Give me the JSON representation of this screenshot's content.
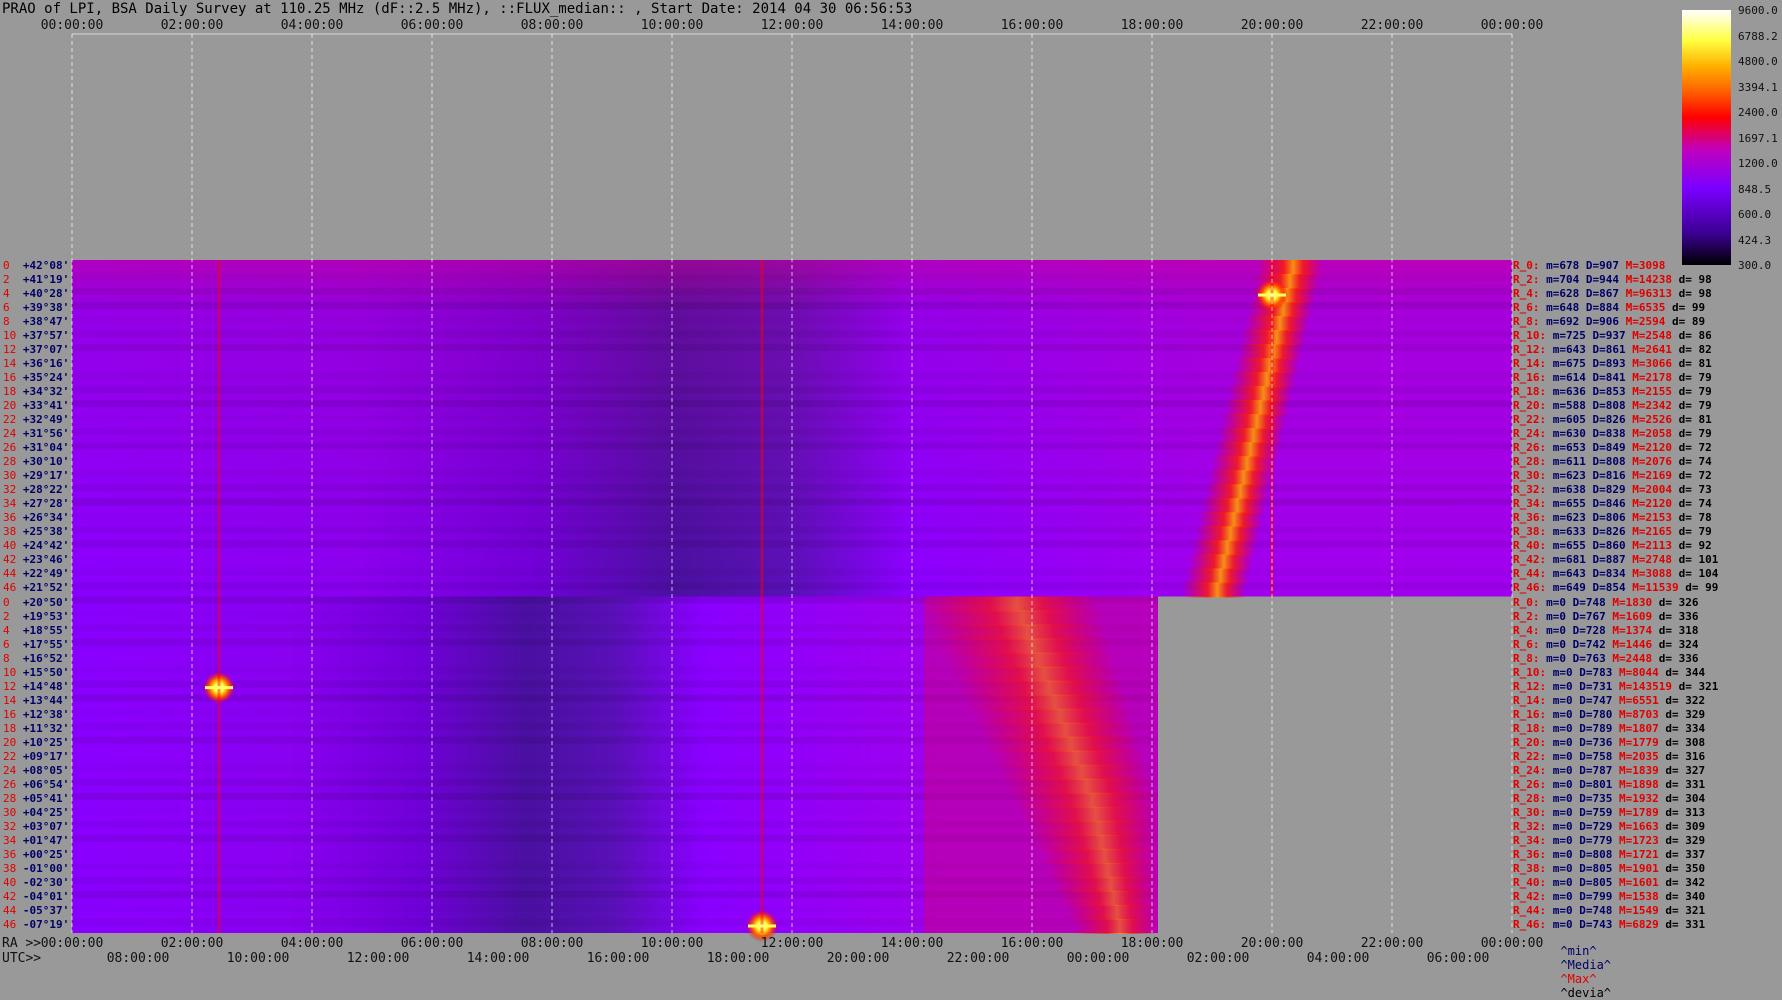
{
  "title": "PRAO of LPI, BSA Daily Survey at 110.25 MHz (dF::2.5 MHz), ::FLUX_median:: , Start Date: 2014 04 30 06:56:53",
  "top_axis_ticks": [
    "00:00:00",
    "02:00:00",
    "04:00:00",
    "06:00:00",
    "08:00:00",
    "10:00:00",
    "12:00:00",
    "14:00:00",
    "16:00:00",
    "18:00:00",
    "20:00:00",
    "22:00:00",
    "00:00:00"
  ],
  "ra_axis": {
    "label": "RA >>",
    "ticks": [
      "00:00:00",
      "02:00:00",
      "04:00:00",
      "06:00:00",
      "08:00:00",
      "10:00:00",
      "12:00:00",
      "14:00:00",
      "16:00:00",
      "18:00:00",
      "20:00:00",
      "22:00:00",
      "00:00:00"
    ]
  },
  "utc_axis": {
    "label": "UTC>>",
    "ticks": [
      "08:00:00",
      "10:00:00",
      "12:00:00",
      "14:00:00",
      "16:00:00",
      "18:00:00",
      "20:00:00",
      "22:00:00",
      "00:00:00",
      "02:00:00",
      "04:00:00",
      "06:00:00"
    ]
  },
  "colorbar": {
    "labels": [
      "9600.0",
      "6788.2",
      "4800.0",
      "3394.1",
      "2400.0",
      "1697.1",
      "1200.0",
      "848.5",
      "600.0",
      "424.3",
      "300.0"
    ]
  },
  "rows": [
    {
      "idx": "0",
      "dec": "+42°08'"
    },
    {
      "idx": "2",
      "dec": "+41°19'"
    },
    {
      "idx": "4",
      "dec": "+40°28'"
    },
    {
      "idx": "6",
      "dec": "+39°38'"
    },
    {
      "idx": "8",
      "dec": "+38°47'"
    },
    {
      "idx": "10",
      "dec": "+37°57'"
    },
    {
      "idx": "12",
      "dec": "+37°07'"
    },
    {
      "idx": "14",
      "dec": "+36°16'"
    },
    {
      "idx": "16",
      "dec": "+35°24'"
    },
    {
      "idx": "18",
      "dec": "+34°32'"
    },
    {
      "idx": "20",
      "dec": "+33°41'"
    },
    {
      "idx": "22",
      "dec": "+32°49'"
    },
    {
      "idx": "24",
      "dec": "+31°56'"
    },
    {
      "idx": "26",
      "dec": "+31°04'"
    },
    {
      "idx": "28",
      "dec": "+30°10'"
    },
    {
      "idx": "30",
      "dec": "+29°17'"
    },
    {
      "idx": "32",
      "dec": "+28°22'"
    },
    {
      "idx": "34",
      "dec": "+27°28'"
    },
    {
      "idx": "36",
      "dec": "+26°34'"
    },
    {
      "idx": "38",
      "dec": "+25°38'"
    },
    {
      "idx": "40",
      "dec": "+24°42'"
    },
    {
      "idx": "42",
      "dec": "+23°46'"
    },
    {
      "idx": "44",
      "dec": "+22°49'"
    },
    {
      "idx": "46",
      "dec": "+21°52'"
    },
    {
      "idx": "0",
      "dec": "+20°50'"
    },
    {
      "idx": "2",
      "dec": "+19°53'"
    },
    {
      "idx": "4",
      "dec": "+18°55'"
    },
    {
      "idx": "6",
      "dec": "+17°55'"
    },
    {
      "idx": "8",
      "dec": "+16°52'"
    },
    {
      "idx": "10",
      "dec": "+15°50'"
    },
    {
      "idx": "12",
      "dec": "+14°48'"
    },
    {
      "idx": "14",
      "dec": "+13°44'"
    },
    {
      "idx": "16",
      "dec": "+12°38'"
    },
    {
      "idx": "18",
      "dec": "+11°32'"
    },
    {
      "idx": "20",
      "dec": "+10°25'"
    },
    {
      "idx": "22",
      "dec": "+09°17'"
    },
    {
      "idx": "24",
      "dec": "+08°05'"
    },
    {
      "idx": "26",
      "dec": "+06°54'"
    },
    {
      "idx": "28",
      "dec": "+05°41'"
    },
    {
      "idx": "30",
      "dec": "+04°25'"
    },
    {
      "idx": "32",
      "dec": "+03°07'"
    },
    {
      "idx": "34",
      "dec": "+01°47'"
    },
    {
      "idx": "36",
      "dec": "+00°25'"
    },
    {
      "idx": "38",
      "dec": "-01°00'"
    },
    {
      "idx": "40",
      "dec": "-02°30'"
    },
    {
      "idx": "42",
      "dec": "-04°01'"
    },
    {
      "idx": "44",
      "dec": "-05°37'"
    },
    {
      "idx": "46",
      "dec": "-07°19'"
    }
  ],
  "stats": [
    {
      "r": "R_0:",
      "m": "m=678",
      "d": "D=907",
      "h": "M=3098",
      "dv": ""
    },
    {
      "r": "R_2:",
      "m": "m=704",
      "d": "D=944",
      "h": "M=14238",
      "dv": "d= 98"
    },
    {
      "r": "R_4:",
      "m": "m=628",
      "d": "D=867",
      "h": "M=96313",
      "dv": "d= 98"
    },
    {
      "r": "R_6:",
      "m": "m=648",
      "d": "D=884",
      "h": "M=6535",
      "dv": "d= 99"
    },
    {
      "r": "R_8:",
      "m": "m=692",
      "d": "D=906",
      "h": "M=2594",
      "dv": "d= 89"
    },
    {
      "r": "R_10:",
      "m": "m=725",
      "d": "D=937",
      "h": "M=2548",
      "dv": "d= 86"
    },
    {
      "r": "R_12:",
      "m": "m=643",
      "d": "D=861",
      "h": "M=2641",
      "dv": "d= 82"
    },
    {
      "r": "R_14:",
      "m": "m=675",
      "d": "D=893",
      "h": "M=3066",
      "dv": "d= 81"
    },
    {
      "r": "R_16:",
      "m": "m=614",
      "d": "D=841",
      "h": "M=2178",
      "dv": "d= 79"
    },
    {
      "r": "R_18:",
      "m": "m=636",
      "d": "D=853",
      "h": "M=2155",
      "dv": "d= 79"
    },
    {
      "r": "R_20:",
      "m": "m=588",
      "d": "D=808",
      "h": "M=2342",
      "dv": "d= 79"
    },
    {
      "r": "R_22:",
      "m": "m=605",
      "d": "D=826",
      "h": "M=2526",
      "dv": "d= 81"
    },
    {
      "r": "R_24:",
      "m": "m=630",
      "d": "D=838",
      "h": "M=2058",
      "dv": "d= 79"
    },
    {
      "r": "R_26:",
      "m": "m=653",
      "d": "D=849",
      "h": "M=2120",
      "dv": "d= 72"
    },
    {
      "r": "R_28:",
      "m": "m=611",
      "d": "D=808",
      "h": "M=2076",
      "dv": "d= 74"
    },
    {
      "r": "R_30:",
      "m": "m=623",
      "d": "D=816",
      "h": "M=2169",
      "dv": "d= 72"
    },
    {
      "r": "R_32:",
      "m": "m=638",
      "d": "D=829",
      "h": "M=2004",
      "dv": "d= 73"
    },
    {
      "r": "R_34:",
      "m": "m=655",
      "d": "D=846",
      "h": "M=2120",
      "dv": "d= 74"
    },
    {
      "r": "R_36:",
      "m": "m=623",
      "d": "D=806",
      "h": "M=2153",
      "dv": "d= 78"
    },
    {
      "r": "R_38:",
      "m": "m=633",
      "d": "D=826",
      "h": "M=2165",
      "dv": "d= 79"
    },
    {
      "r": "R_40:",
      "m": "m=655",
      "d": "D=860",
      "h": "M=2113",
      "dv": "d= 92"
    },
    {
      "r": "R_42:",
      "m": "m=681",
      "d": "D=887",
      "h": "M=2748",
      "dv": "d= 101"
    },
    {
      "r": "R_44:",
      "m": "m=643",
      "d": "D=834",
      "h": "M=3088",
      "dv": "d= 104"
    },
    {
      "r": "R_46:",
      "m": "m=649",
      "d": "D=854",
      "h": "M=11539",
      "dv": "d= 99"
    },
    {
      "r": "R_0:",
      "m": "m=0",
      "d": "D=748",
      "h": "M=1830",
      "dv": "d= 326"
    },
    {
      "r": "R_2:",
      "m": "m=0",
      "d": "D=767",
      "h": "M=1609",
      "dv": "d= 336"
    },
    {
      "r": "R_4:",
      "m": "m=0",
      "d": "D=728",
      "h": "M=1374",
      "dv": "d= 318"
    },
    {
      "r": "R_6:",
      "m": "m=0",
      "d": "D=742",
      "h": "M=1446",
      "dv": "d= 324"
    },
    {
      "r": "R_8:",
      "m": "m=0",
      "d": "D=763",
      "h": "M=2448",
      "dv": "d= 336"
    },
    {
      "r": "R_10:",
      "m": "m=0",
      "d": "D=783",
      "h": "M=8044",
      "dv": "d= 344"
    },
    {
      "r": "R_12:",
      "m": "m=0",
      "d": "D=731",
      "h": "M=143519",
      "dv": "d= 321"
    },
    {
      "r": "R_14:",
      "m": "m=0",
      "d": "D=747",
      "h": "M=6551",
      "dv": "d= 322"
    },
    {
      "r": "R_16:",
      "m": "m=0",
      "d": "D=780",
      "h": "M=8703",
      "dv": "d= 329"
    },
    {
      "r": "R_18:",
      "m": "m=0",
      "d": "D=789",
      "h": "M=1807",
      "dv": "d= 334"
    },
    {
      "r": "R_20:",
      "m": "m=0",
      "d": "D=736",
      "h": "M=1779",
      "dv": "d= 308"
    },
    {
      "r": "R_22:",
      "m": "m=0",
      "d": "D=758",
      "h": "M=2035",
      "dv": "d= 316"
    },
    {
      "r": "R_24:",
      "m": "m=0",
      "d": "D=787",
      "h": "M=1839",
      "dv": "d= 327"
    },
    {
      "r": "R_26:",
      "m": "m=0",
      "d": "D=801",
      "h": "M=1898",
      "dv": "d= 331"
    },
    {
      "r": "R_28:",
      "m": "m=0",
      "d": "D=735",
      "h": "M=1932",
      "dv": "d= 304"
    },
    {
      "r": "R_30:",
      "m": "m=0",
      "d": "D=759",
      "h": "M=1789",
      "dv": "d= 313"
    },
    {
      "r": "R_32:",
      "m": "m=0",
      "d": "D=729",
      "h": "M=1663",
      "dv": "d= 309"
    },
    {
      "r": "R_34:",
      "m": "m=0",
      "d": "D=779",
      "h": "M=1723",
      "dv": "d= 329"
    },
    {
      "r": "R_36:",
      "m": "m=0",
      "d": "D=808",
      "h": "M=1721",
      "dv": "d= 337"
    },
    {
      "r": "R_38:",
      "m": "m=0",
      "d": "D=805",
      "h": "M=1901",
      "dv": "d= 350"
    },
    {
      "r": "R_40:",
      "m": "m=0",
      "d": "D=805",
      "h": "M=1601",
      "dv": "d= 342"
    },
    {
      "r": "R_42:",
      "m": "m=0",
      "d": "D=799",
      "h": "M=1538",
      "dv": "d= 340"
    },
    {
      "r": "R_44:",
      "m": "m=0",
      "d": "D=748",
      "h": "M=1549",
      "dv": "d= 321"
    },
    {
      "r": "R_46:",
      "m": "m=0",
      "d": "D=743",
      "h": "M=6829",
      "dv": "d= 331"
    }
  ],
  "bottom_legend": {
    "min": "^min^",
    "median": "^Media^",
    "max": "^Max^",
    "devia": "^devia^"
  },
  "chart_data": {
    "type": "heatmap",
    "title": "PRAO of LPI, BSA Daily Survey at 110.25 MHz (dF::2.5 MHz), ::FLUX_median:: , Start Date: 2014 04 30 06:56:53",
    "x_unit": "RA (hours)",
    "x_range": [
      0,
      24
    ],
    "y_labels_count": 48,
    "color_scale": "log",
    "color_range": [
      300.0,
      9600.0
    ],
    "colors": {
      "low": "#000000",
      "mid1": "#5a00b4",
      "mid2": "#a000ff",
      "mid3": "#ff0000",
      "high": "#ffff00",
      "top": "#ffffff",
      "missing": "#999999"
    },
    "upper_block_covered_to_ra": 24,
    "lower_block_covered_to_ra": 18.1,
    "sources": [
      {
        "ra": 2.45,
        "dec_row": 30,
        "label": "bright"
      },
      {
        "ra": 20.0,
        "dec_row": 2,
        "label": "bright"
      },
      {
        "ra": 11.5,
        "dec_row": 47,
        "label": "bright"
      }
    ]
  }
}
